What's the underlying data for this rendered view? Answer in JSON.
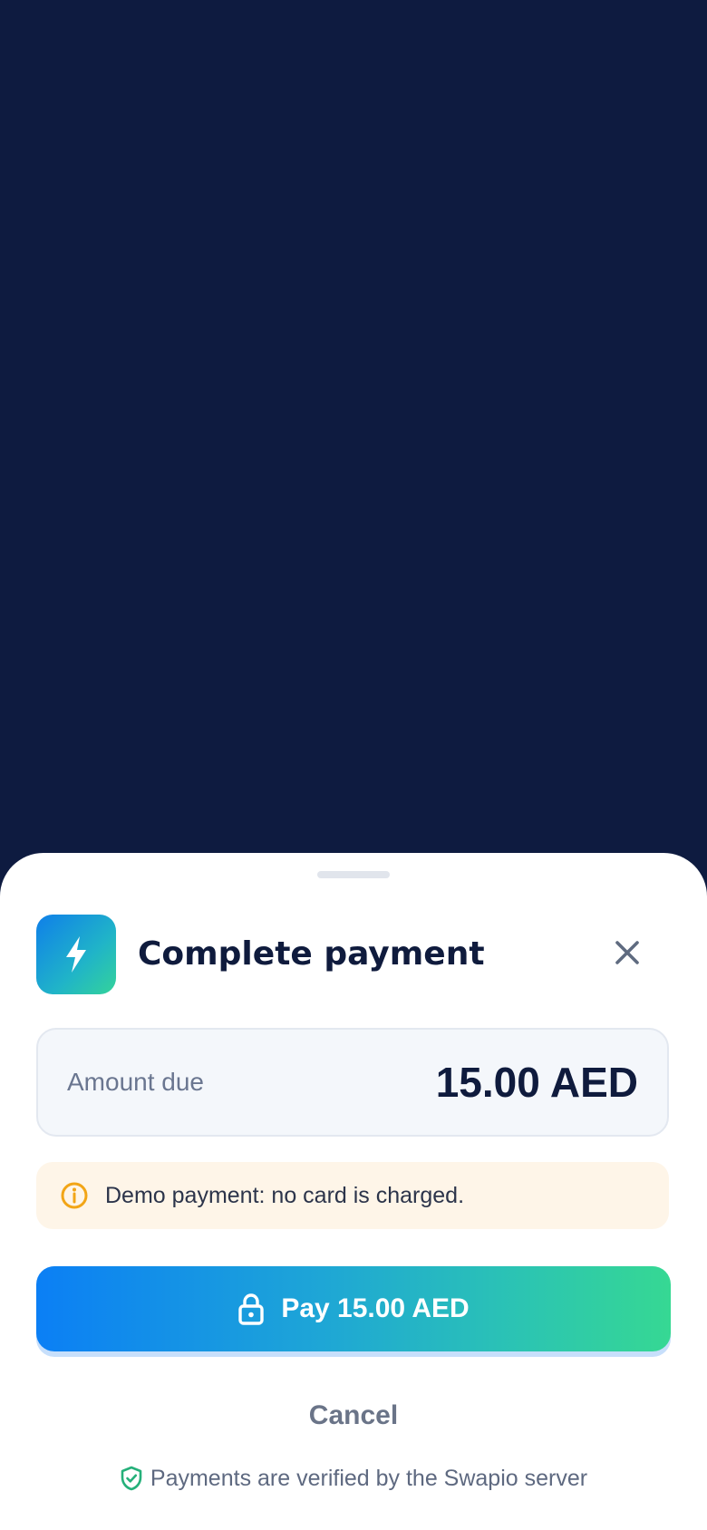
{
  "sheet": {
    "title": "Complete payment",
    "amount_label": "Amount due",
    "amount_value": "15.00 AED",
    "notice": "Demo payment: no card is charged.",
    "pay_label": "Pay 15.00 AED",
    "cancel_label": "Cancel",
    "footer": "Payments are verified by the Swapio server"
  },
  "icons": {
    "app": "lightning-bolt-icon",
    "close": "close-icon",
    "notice": "info-icon",
    "pay": "lock-icon",
    "footer": "shield-check-icon"
  },
  "colors": {
    "backdrop": "#0e1b40",
    "title": "#0f1b3d",
    "accent_start": "#0b7ff5",
    "accent_end": "#36d893",
    "notice_bg": "#fef5e8",
    "warning": "#f2a516",
    "verified": "#25b07a"
  }
}
